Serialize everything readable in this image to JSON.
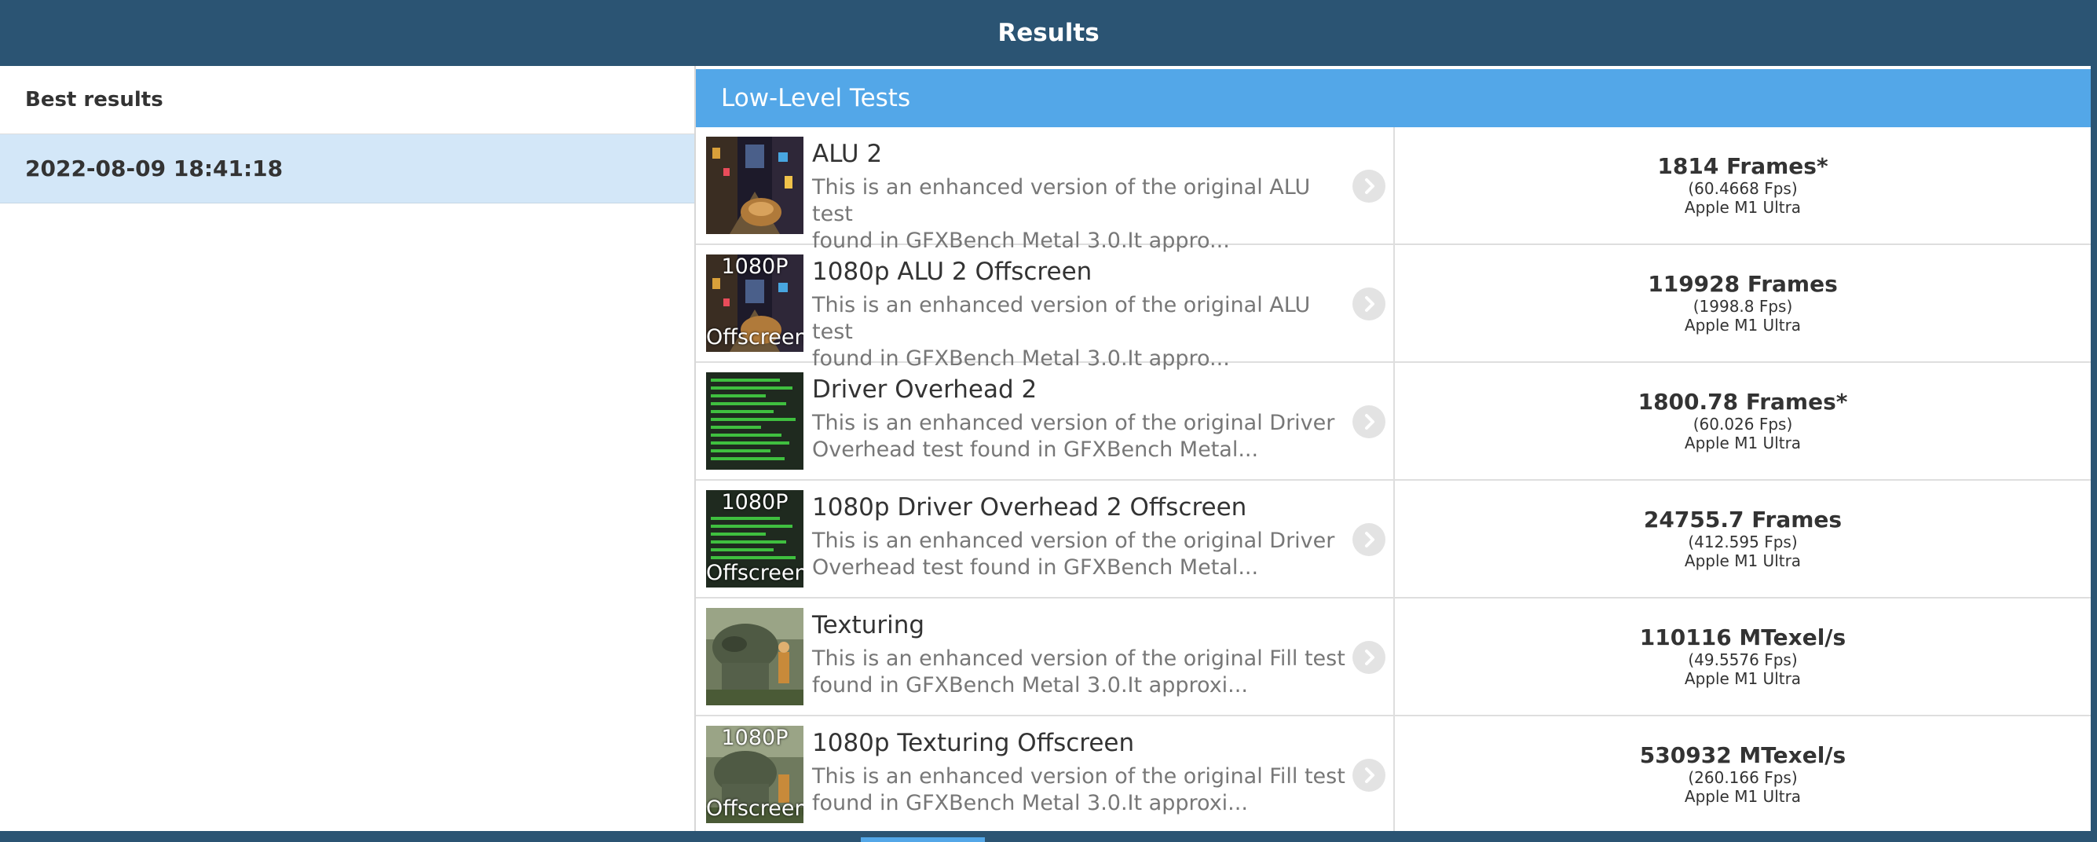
{
  "window": {
    "title": "Results"
  },
  "sidebar": {
    "heading": "Best results",
    "entries": [
      {
        "label": "2022-08-09 18:41:18"
      }
    ]
  },
  "main": {
    "section_title": "Low-Level Tests",
    "tests": [
      {
        "name": "ALU 2",
        "description_line1": "This is an enhanced version of the original ALU test",
        "description_line2": "found in GFXBench Metal 3.0.It appro...",
        "score": "1814 Frames*",
        "fps": "(60.4668 Fps)",
        "device": "Apple M1 Ultra",
        "thumbnail": "alu-scene",
        "badge_top": "",
        "badge_bottom": ""
      },
      {
        "name": "1080p ALU 2 Offscreen",
        "description_line1": "This is an enhanced version of the original ALU test",
        "description_line2": "found in GFXBench Metal 3.0.It appro...",
        "score": "119928 Frames",
        "fps": "(1998.8 Fps)",
        "device": "Apple M1 Ultra",
        "thumbnail": "alu-scene",
        "badge_top": "1080P",
        "badge_bottom": "Offscreen"
      },
      {
        "name": "Driver Overhead 2",
        "description_line1": "This is an enhanced version of the original Driver",
        "description_line2": "Overhead test found in GFXBench Metal...",
        "score": "1800.78 Frames*",
        "fps": "(60.026 Fps)",
        "device": "Apple M1 Ultra",
        "thumbnail": "driver-bars",
        "badge_top": "",
        "badge_bottom": ""
      },
      {
        "name": "1080p Driver Overhead 2 Offscreen",
        "description_line1": "This is an enhanced version of the original Driver",
        "description_line2": "Overhead test found in GFXBench Metal...",
        "score": "24755.7 Frames",
        "fps": "(412.595 Fps)",
        "device": "Apple M1 Ultra",
        "thumbnail": "driver-bars",
        "badge_top": "1080P",
        "badge_bottom": "Offscreen"
      },
      {
        "name": "Texturing",
        "description_line1": "This is an enhanced version of the original Fill test",
        "description_line2": "found in GFXBench Metal 3.0.It approxi...",
        "score": "110116 MTexel/s",
        "fps": "(49.5576 Fps)",
        "device": "Apple M1 Ultra",
        "thumbnail": "dinosaur-scene",
        "badge_top": "",
        "badge_bottom": ""
      },
      {
        "name": "1080p Texturing Offscreen",
        "description_line1": "This is an enhanced version of the original Fill test",
        "description_line2": "found in GFXBench Metal 3.0.It approxi...",
        "score": "530932 MTexel/s",
        "fps": "(260.166 Fps)",
        "device": "Apple M1 Ultra",
        "thumbnail": "dinosaur-scene",
        "badge_top": "1080P",
        "badge_bottom": "Offscreen"
      }
    ]
  },
  "colors": {
    "titlebar": "#2b5473",
    "section_header": "#53a7e8",
    "selected_entry": "#d3e7f8"
  }
}
